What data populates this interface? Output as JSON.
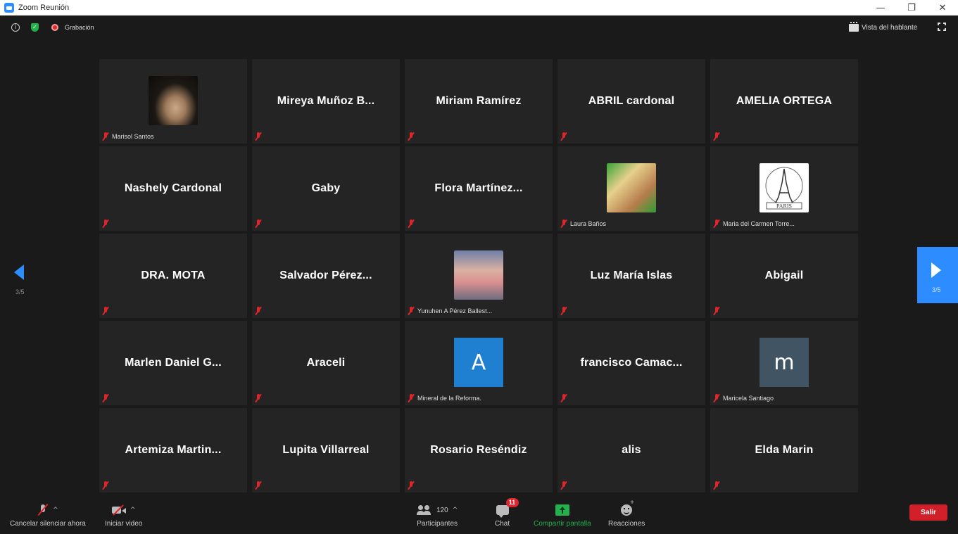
{
  "window": {
    "title": "Zoom Reunión",
    "controls": [
      "—",
      "❐",
      "✕"
    ]
  },
  "topbar": {
    "recording_label": "Grabación",
    "speaker_view_label": "Vista del hablante"
  },
  "pagination": {
    "left_page": "3/5",
    "right_page": "3/5"
  },
  "participants": [
    {
      "name": "Marisol Santos",
      "display": "photo",
      "photo": "dog",
      "muted": true
    },
    {
      "name": "Mireya Muñoz B...",
      "display": "name",
      "muted": true
    },
    {
      "name": "Miriam Ramírez",
      "display": "name",
      "muted": true
    },
    {
      "name": "ABRIL cardonal",
      "display": "name",
      "muted": true
    },
    {
      "name": "AMELIA ORTEGA",
      "display": "name",
      "muted": true
    },
    {
      "name": "Nashely Cardonal",
      "display": "name",
      "muted": true
    },
    {
      "name": "Gaby",
      "display": "name",
      "muted": true
    },
    {
      "name": "Flora Martínez...",
      "display": "name",
      "muted": true
    },
    {
      "name": "Laura Baños",
      "display": "photo",
      "photo": "laura",
      "muted": true
    },
    {
      "name": "Maria del Carmen Torre...",
      "display": "photo",
      "photo": "paris",
      "photo_caption": "PARIS",
      "muted": true
    },
    {
      "name": "DRA. MOTA",
      "display": "name",
      "muted": true
    },
    {
      "name": "Salvador Pérez...",
      "display": "name",
      "muted": true
    },
    {
      "name": "Yunuhen A Pérez Ballest...",
      "display": "photo",
      "photo": "yunuhen",
      "muted": true
    },
    {
      "name": "Luz María Islas",
      "display": "name",
      "muted": true
    },
    {
      "name": "Abigail",
      "display": "name",
      "muted": true
    },
    {
      "name": "Marlen Daniel G...",
      "display": "name",
      "muted": true
    },
    {
      "name": "Araceli",
      "display": "name",
      "muted": true
    },
    {
      "name": "Mineral de la Reforma.",
      "display": "letter",
      "letter": "A",
      "letter_color": "#1f7fd1",
      "muted": true
    },
    {
      "name": "francisco  Camac...",
      "display": "name",
      "muted": true
    },
    {
      "name": "Maricela Santiago",
      "display": "letter",
      "letter": "m",
      "letter_color": "#415463",
      "muted": true
    },
    {
      "name": "Artemiza  Martin...",
      "display": "name",
      "muted": true
    },
    {
      "name": "Lupita Villarreal",
      "display": "name",
      "muted": true
    },
    {
      "name": "Rosario Reséndiz",
      "display": "name",
      "muted": true
    },
    {
      "name": "alis",
      "display": "name",
      "muted": true
    },
    {
      "name": "Elda Marin",
      "display": "name",
      "muted": true
    }
  ],
  "toolbar": {
    "unmute_label": "Cancelar silenciar ahora",
    "start_video_label": "Iniciar video",
    "participants_label": "Participantes",
    "participants_count": "120",
    "chat_label": "Chat",
    "chat_badge": "11",
    "share_label": "Compartir pantalla",
    "reactions_label": "Reacciones",
    "leave_label": "Salir"
  },
  "colors": {
    "accent": "#2d8cff",
    "leave": "#d1202a",
    "share": "#23b14d",
    "muted": "#e0242b",
    "tile_bg": "#242424"
  }
}
